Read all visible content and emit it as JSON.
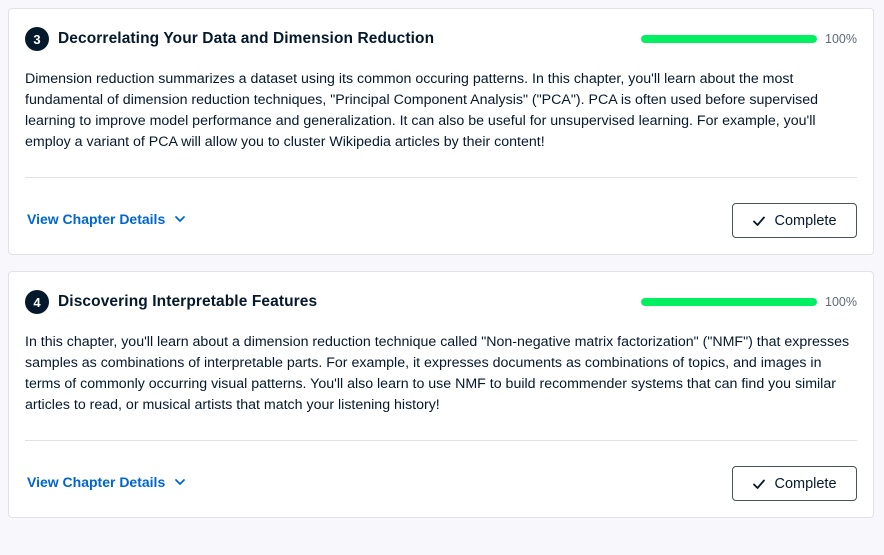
{
  "chapters": [
    {
      "number": "3",
      "title": "Decorrelating Your Data and Dimension Reduction",
      "progress": 100,
      "progress_label": "100%",
      "description": "Dimension reduction summarizes a dataset using its common occuring patterns. In this chapter, you'll learn about the most fundamental of dimension reduction techniques, \"Principal Component Analysis\" (\"PCA\"). PCA is often used before supervised learning to improve model performance and generalization. It can also be useful for unsupervised learning. For example, you'll employ a variant of PCA will allow you to cluster Wikipedia articles by their content!",
      "details_label": "View Chapter Details",
      "status_label": "Complete"
    },
    {
      "number": "4",
      "title": "Discovering Interpretable Features",
      "progress": 100,
      "progress_label": "100%",
      "description": "In this chapter, you'll learn about a dimension reduction technique called \"Non-negative matrix factorization\" (\"NMF\") that expresses samples as combinations of interpretable parts. For example, it expresses documents as combinations of topics, and images in terms of commonly occurring visual patterns. You'll also learn to use NMF to build recommender systems that can find you similar articles to read, or musical artists that match your listening history!",
      "details_label": "View Chapter Details",
      "status_label": "Complete"
    }
  ],
  "icons": {
    "details": "chevron-down-icon",
    "status": "check-icon"
  },
  "colors": {
    "progress_fill": "#03ef62",
    "link": "#0065d1",
    "badge": "#05192d"
  }
}
